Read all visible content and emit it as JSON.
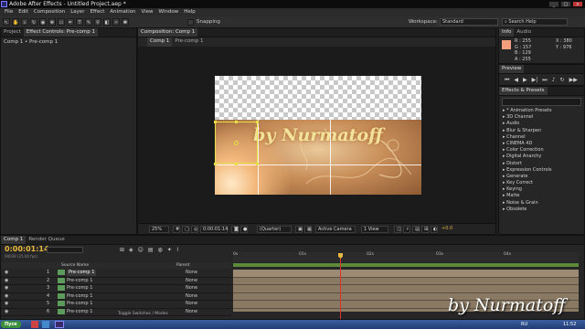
{
  "window": {
    "title": "Adobe After Effects - Untitled Project.aep *"
  },
  "menubar": {
    "items": [
      "File",
      "Edit",
      "Composition",
      "Layer",
      "Effect",
      "Animation",
      "View",
      "Window",
      "Help"
    ]
  },
  "toolbar": {
    "snapping_label": "Snapping",
    "workspace_label": "Workspace:",
    "workspace_value": "Standard",
    "search_placeholder": "Search Help"
  },
  "left_panel": {
    "tabs": [
      "Project",
      "Effect Controls: Pre-comp 1"
    ],
    "breadcrumb": "Comp 1 • Pre-comp 1"
  },
  "viewer": {
    "tab_label": "Composition: Comp 1",
    "subtabs": [
      "Comp 1",
      "Pre-comp 1"
    ],
    "layer_title": "by Nurmatoff",
    "bottom": {
      "zoom": "25%",
      "timecode": "0:00:01:14",
      "resolution": "(Quarter)",
      "camera": "Active Camera",
      "views": "1 View",
      "exposure": "+0.0"
    }
  },
  "info_panel": {
    "tabs": [
      "Info",
      "Audio"
    ],
    "r": "R : 255",
    "g": "G : 157",
    "b": "B : 129",
    "a": "A : 255",
    "x": "X : 380",
    "y": "Y : 976",
    "swatch_color": "#f4a07e"
  },
  "preview_panel": {
    "tab": "Preview"
  },
  "effects_panel": {
    "tab": "Effects & Presets",
    "search": "",
    "items": [
      "* Animation Presets",
      "3D Channel",
      "Audio",
      "Blur & Sharpen",
      "Channel",
      "CINEMA 4D",
      "Color Correction",
      "Digital Anarchy",
      "Distort",
      "Expression Controls",
      "Generate",
      "Key Correct",
      "Keying",
      "Matte",
      "Noise & Grain",
      "Obsolete"
    ]
  },
  "timeline": {
    "tabs": [
      "Comp 1",
      "Render Queue"
    ],
    "timecode": "0:00:01:14",
    "fps": "00039 (25.00 fps)",
    "columns": {
      "source": "Source Name",
      "parent": "Parent"
    },
    "layers": [
      {
        "num": "1",
        "name": "Pre-comp 1",
        "parent": "None"
      },
      {
        "num": "2",
        "name": "Pre-comp 1",
        "parent": "None"
      },
      {
        "num": "3",
        "name": "Pre-comp 1",
        "parent": "None"
      },
      {
        "num": "4",
        "name": "Pre-comp 1",
        "parent": "None"
      },
      {
        "num": "5",
        "name": "Pre-comp 1",
        "parent": "None"
      },
      {
        "num": "6",
        "name": "Pre-comp 1",
        "parent": "None"
      }
    ],
    "ruler": [
      "0s",
      "01s",
      "02s",
      "03s",
      "04s"
    ],
    "footer": "Toggle Switches / Modes"
  },
  "taskbar": {
    "start_label": "Пуск",
    "lang": "RU",
    "clock": "11:52"
  },
  "watermark": "by Nurmatoff"
}
